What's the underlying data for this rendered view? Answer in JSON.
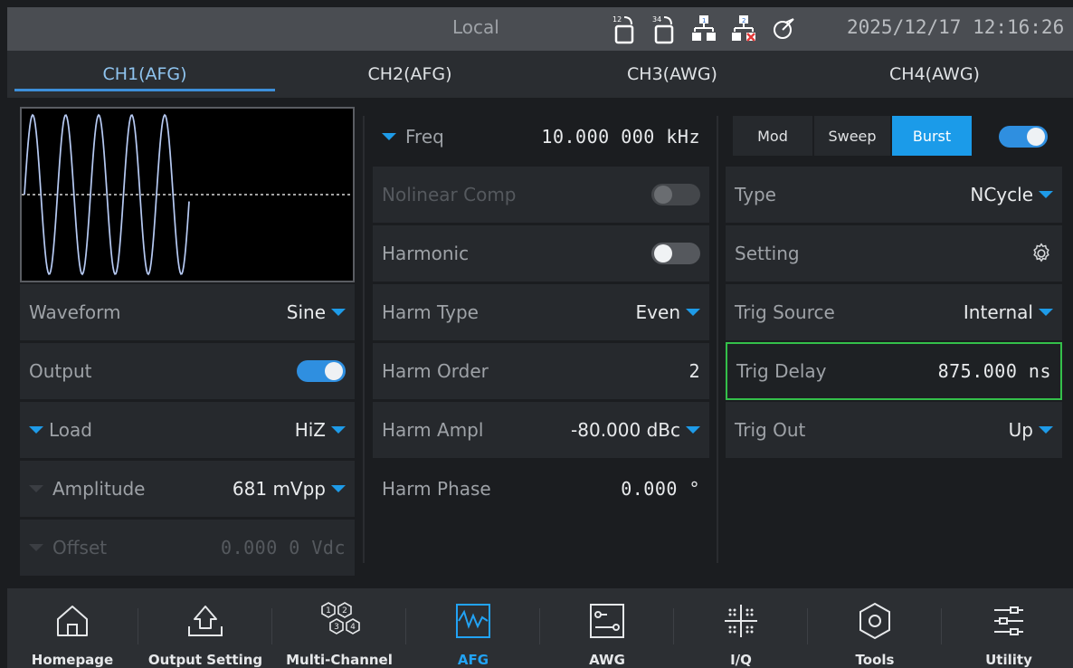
{
  "status": {
    "mode": "Local",
    "datetime": "2025/12/17 12:16:26",
    "icons": [
      "ch12-link-icon",
      "ch34-link-icon",
      "network-1-icon",
      "network-2-disconnected-icon",
      "sync-icon"
    ],
    "icon_badges": [
      "12",
      "34",
      "1",
      "2"
    ]
  },
  "tabs": [
    {
      "label": "CH1(AFG)",
      "active": true
    },
    {
      "label": "CH2(AFG)",
      "active": false
    },
    {
      "label": "CH3(AWG)",
      "active": false
    },
    {
      "label": "CH4(AWG)",
      "active": false
    }
  ],
  "left": {
    "waveform": {
      "label": "Waveform",
      "value": "Sine"
    },
    "output": {
      "label": "Output",
      "state": "on"
    },
    "load": {
      "label": "Load",
      "value": "HiZ"
    },
    "amplitude": {
      "label": "Amplitude",
      "value": "681 mVpp"
    },
    "offset": {
      "label": "Offset",
      "value": "0.000 0 Vdc"
    }
  },
  "middle": {
    "freq": {
      "label": "Freq",
      "value": "10.000 000 kHz"
    },
    "nonlinear": {
      "label": "Nolinear Comp",
      "state": "disabled"
    },
    "harmonic": {
      "label": "Harmonic",
      "state": "off"
    },
    "harm_type": {
      "label": "Harm Type",
      "value": "Even"
    },
    "harm_order": {
      "label": "Harm Order",
      "value": "2"
    },
    "harm_ampl": {
      "label": "Harm Ampl",
      "value": "-80.000 dBc"
    },
    "harm_phase": {
      "label": "Harm Phase",
      "value": "0.000 °"
    }
  },
  "right": {
    "modes": [
      "Mod",
      "Sweep",
      "Burst"
    ],
    "active_mode": "Burst",
    "burst_enabled": "on",
    "type": {
      "label": "Type",
      "value": "NCycle"
    },
    "setting": {
      "label": "Setting"
    },
    "trig_source": {
      "label": "Trig Source",
      "value": "Internal"
    },
    "trig_delay": {
      "label": "Trig Delay",
      "value": "875.000 ns"
    },
    "trig_out": {
      "label": "Trig Out",
      "value": "Up"
    }
  },
  "nav": [
    {
      "label": "Homepage",
      "icon": "home-icon"
    },
    {
      "label": "Output Setting",
      "icon": "output-setting-icon"
    },
    {
      "label": "Multi-Channel",
      "icon": "multi-channel-icon"
    },
    {
      "label": "AFG",
      "icon": "afg-icon",
      "active": true
    },
    {
      "label": "AWG",
      "icon": "awg-icon"
    },
    {
      "label": "I/Q",
      "icon": "iq-icon"
    },
    {
      "label": "Tools",
      "icon": "tools-icon"
    },
    {
      "label": "Utility",
      "icon": "utility-icon"
    }
  ],
  "colors": {
    "accent": "#1b9be9",
    "selection": "#34c04a",
    "background": "#1b1d20"
  }
}
